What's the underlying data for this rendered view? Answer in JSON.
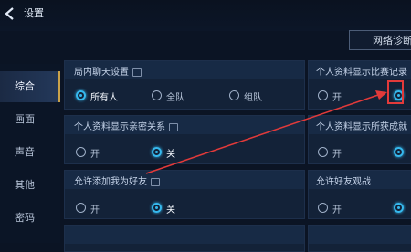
{
  "header": {
    "title": "设置",
    "network_button": "网络诊断"
  },
  "sidebar": {
    "items": [
      {
        "label": "综合"
      },
      {
        "label": "画面"
      },
      {
        "label": "声音"
      },
      {
        "label": "其他"
      },
      {
        "label": "密码"
      }
    ],
    "active": "综合"
  },
  "settings": {
    "lobby_chat": {
      "title": "局内聊天设置",
      "options": [
        "所有人",
        "全队",
        "组队"
      ],
      "selected": "所有人"
    },
    "show_match_record": {
      "title": "个人资料显示比赛记录",
      "options": [
        "开"
      ]
    },
    "show_intimacy": {
      "title": "个人资料显示亲密关系",
      "options": [
        "开",
        "关"
      ],
      "selected": "关"
    },
    "show_achievement": {
      "title": "个人资料显示所获成就",
      "options": [
        "开"
      ]
    },
    "allow_add_friend": {
      "title": "允许添加我为好友",
      "options": [
        "开",
        "关"
      ],
      "selected": "关"
    },
    "allow_spectate": {
      "title": "允许好友观战",
      "options": [
        "开"
      ]
    }
  },
  "colors": {
    "accent": "#36b9ee",
    "highlight": "#e23a3a",
    "active_bar": "#c9a24a"
  }
}
